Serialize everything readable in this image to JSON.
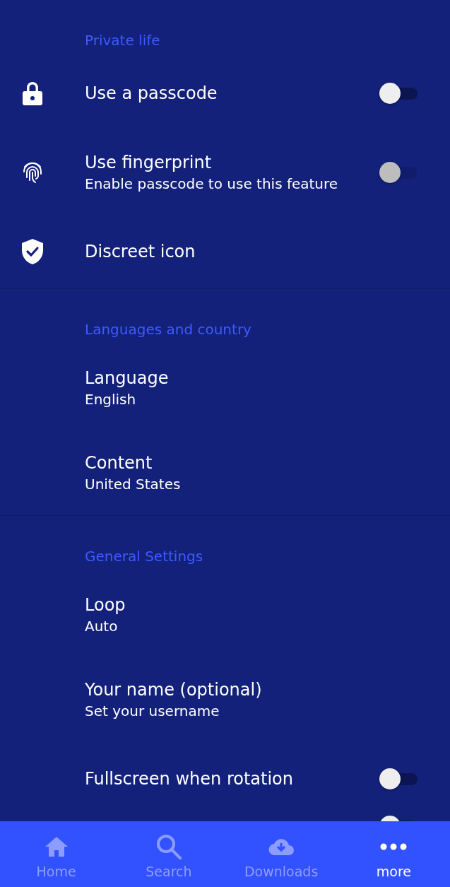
{
  "sections": [
    {
      "title": "Private life",
      "items": [
        {
          "kind": "toggle",
          "title": "Use a passcode",
          "on": false,
          "disabled": false
        },
        {
          "kind": "toggle",
          "title": "Use fingerprint",
          "subtitle": "Enable passcode to use this feature",
          "on": false,
          "disabled": true
        },
        {
          "kind": "link",
          "title": "Discreet icon"
        }
      ]
    },
    {
      "title": "Languages and country",
      "items": [
        {
          "kind": "link",
          "title": "Language",
          "subtitle": "English"
        },
        {
          "kind": "link",
          "title": "Content",
          "subtitle": "United States"
        }
      ]
    },
    {
      "title": "General Settings",
      "items": [
        {
          "kind": "link",
          "title": "Loop",
          "subtitle": "Auto"
        },
        {
          "kind": "link",
          "title": "Your name (optional)",
          "subtitle": "Set your username"
        },
        {
          "kind": "toggle",
          "title": "Fullscreen when rotation",
          "on": false,
          "disabled": false
        },
        {
          "kind": "toggle",
          "on": false
        }
      ]
    }
  ],
  "bottom_nav": [
    {
      "label": "Home",
      "selected": false
    },
    {
      "label": "Search",
      "selected": false
    },
    {
      "label": "Downloads",
      "selected": false
    },
    {
      "label": "more",
      "selected": true
    }
  ]
}
